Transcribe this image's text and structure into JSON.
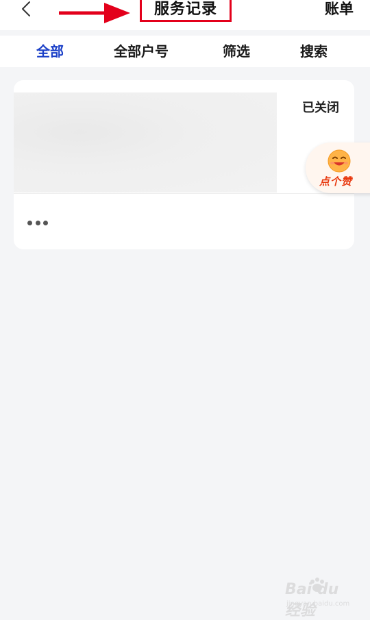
{
  "header": {
    "title": "服务记录",
    "bill_label": "账单",
    "icons": {
      "back": "chevron-left-icon",
      "annotation_arrow": "right-arrow-icon"
    },
    "annotation_color": "#e3001b"
  },
  "tabs": [
    {
      "label": "全部",
      "active": true
    },
    {
      "label": "全部户号",
      "active": false
    },
    {
      "label": "筛选",
      "active": false
    },
    {
      "label": "搜索",
      "active": false
    }
  ],
  "accent_color": "#1a3fc7",
  "record_card": {
    "status": "已关闭",
    "more_icon": "more-dots-icon"
  },
  "like_button": {
    "label": "点个赞",
    "icon": "smiley-face-icon",
    "color": "#e8380e"
  },
  "watermark": {
    "brand": "Bai du 经验",
    "sub": "jingyan.baidu.com"
  }
}
